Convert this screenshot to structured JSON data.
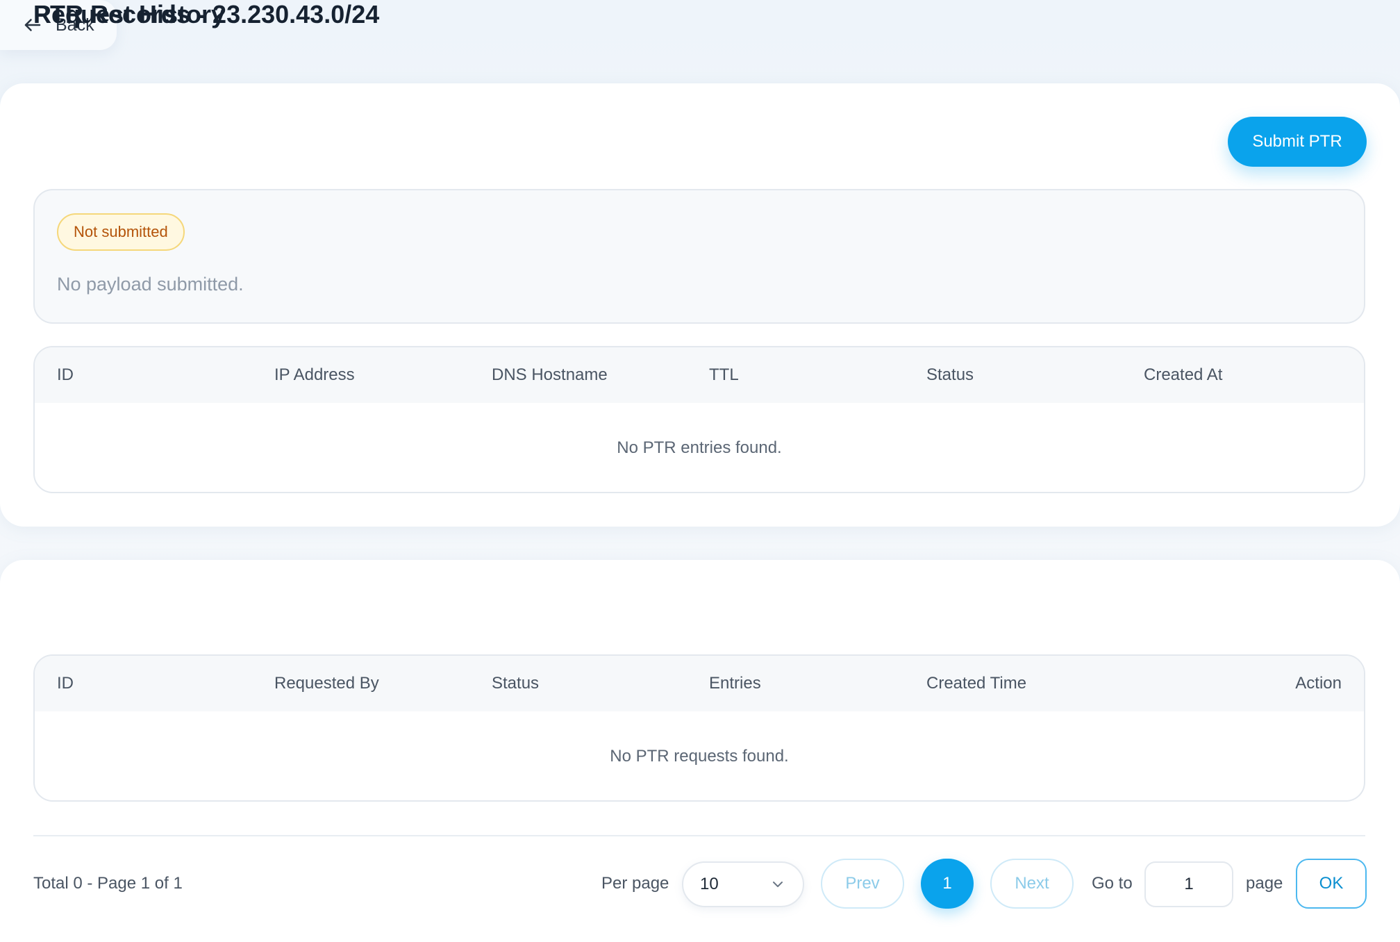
{
  "nav": {
    "back_label": "Back"
  },
  "ptr": {
    "title": "PTR Records - 23.230.43.0/24",
    "submit_label": "Submit PTR",
    "status_badge": "Not submitted",
    "payload_text": "No payload submitted.",
    "columns": [
      "ID",
      "IP Address",
      "DNS Hostname",
      "TTL",
      "Status",
      "Created At"
    ],
    "empty_text": "No PTR entries found."
  },
  "history": {
    "title": "Request History",
    "columns": [
      "ID",
      "Requested By",
      "Status",
      "Entries",
      "Created Time",
      "Action"
    ],
    "empty_text": "No PTR requests found."
  },
  "pagination": {
    "total_text": "Total 0 - Page 1 of 1",
    "per_page_label": "Per page",
    "per_page_value": "10",
    "prev_label": "Prev",
    "current_page": "1",
    "next_label": "Next",
    "goto_label": "Go to",
    "goto_value": "1",
    "page_label": "page",
    "ok_label": "OK"
  },
  "colors": {
    "accent": "#0aa3ec",
    "badge_bg": "#fff8e1",
    "badge_text": "#b45309"
  },
  "icons": {
    "back": "arrow-left-icon",
    "select": "chevron-down-icon"
  }
}
